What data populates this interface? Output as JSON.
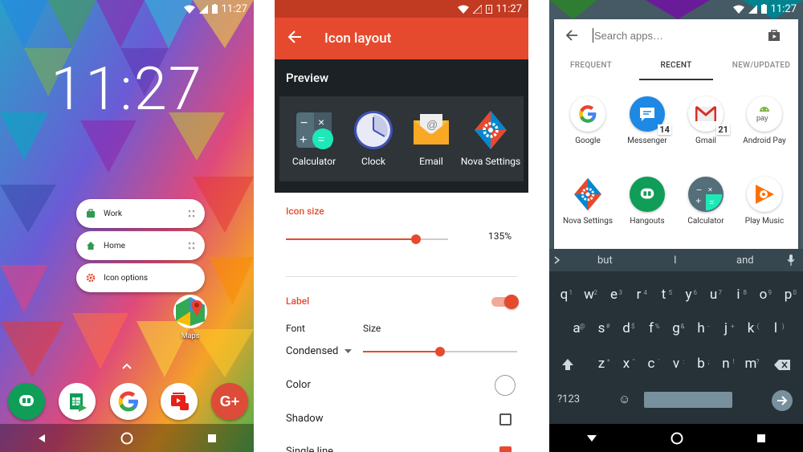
{
  "status": {
    "time": "11:27"
  },
  "home": {
    "clock": "11:27",
    "popup": [
      {
        "label": "Work",
        "icon": "briefcase-icon"
      },
      {
        "label": "Home",
        "icon": "home-icon"
      },
      {
        "label": "Icon options",
        "icon": "gear-icon"
      }
    ],
    "maps_label": "Maps",
    "dock": [
      "hangouts-icon",
      "sheets-icon",
      "google-icon",
      "youtube-icon",
      "google-plus-icon"
    ]
  },
  "settings": {
    "title": "Icon layout",
    "preview_label": "Preview",
    "preview_apps": [
      "Calculator",
      "Clock",
      "Email",
      "Nova Settings"
    ],
    "icon_size_section": "Icon size",
    "icon_size_value": "135%",
    "icon_size_fraction": 0.8,
    "label_section": "Label",
    "label_toggle": true,
    "font_label": "Font",
    "size_label": "Size",
    "font_value": "Condensed",
    "label_size_fraction": 0.5,
    "color_label": "Color",
    "shadow_label": "Shadow",
    "single_line_label": "Single line",
    "accent": "#e64a2e"
  },
  "drawer": {
    "search_placeholder": "Search apps…",
    "tabs": [
      "FREQUENT",
      "RECENT",
      "NEW/UPDATED"
    ],
    "active_tab": "RECENT",
    "apps": [
      {
        "label": "Google",
        "badge": ""
      },
      {
        "label": "Messenger",
        "badge": "14"
      },
      {
        "label": "Gmail",
        "badge": "21"
      },
      {
        "label": "Android Pay",
        "badge": ""
      },
      {
        "label": "Nova Settings",
        "badge": ""
      },
      {
        "label": "Hangouts",
        "badge": ""
      },
      {
        "label": "Calculator",
        "badge": ""
      },
      {
        "label": "Play Music",
        "badge": ""
      }
    ],
    "suggestions": [
      "but",
      "I",
      "and"
    ],
    "keys_row1": [
      "q",
      "w",
      "e",
      "r",
      "t",
      "y",
      "u",
      "i",
      "o",
      "p"
    ],
    "keys_row1_alt": [
      "1",
      "2",
      "3",
      "4",
      "5",
      "6",
      "7",
      "8",
      "9",
      "0"
    ],
    "keys_row2": [
      "a",
      "s",
      "d",
      "f",
      "g",
      "h",
      "j",
      "k",
      "l"
    ],
    "keys_row2_alt": [
      "@",
      "#",
      "$",
      "%",
      "&",
      "-",
      "+",
      "(",
      ")"
    ],
    "keys_row3": [
      "z",
      "x",
      "c",
      "v",
      "b",
      "n",
      "m"
    ],
    "keys_row3_alt": [
      "*",
      "\"",
      "'",
      ":",
      ";",
      "!",
      "?"
    ],
    "sym_key": "?123",
    "emoji_key": "☺"
  }
}
